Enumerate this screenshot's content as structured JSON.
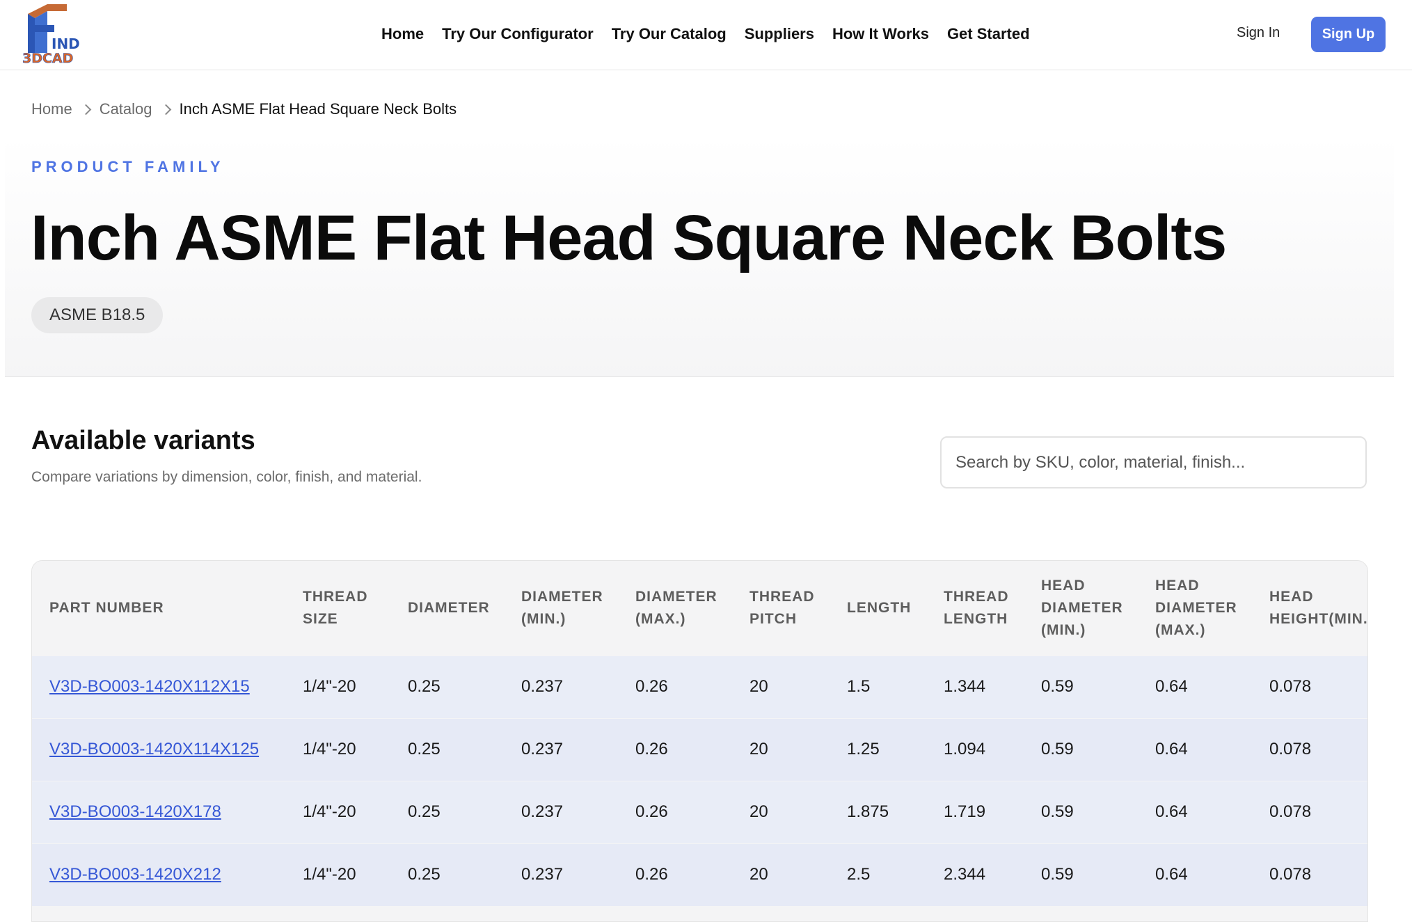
{
  "brand": {
    "logo_alt": "FIND 3DCAD",
    "logo_text_top": "IND",
    "logo_text_bottom": "3DCAD"
  },
  "nav": {
    "items": [
      {
        "label": "Home"
      },
      {
        "label": "Try Our Configurator"
      },
      {
        "label": "Try Our Catalog"
      },
      {
        "label": "Suppliers"
      },
      {
        "label": "How It Works"
      },
      {
        "label": "Get Started"
      }
    ],
    "sign_in": "Sign In",
    "sign_up": "Sign Up"
  },
  "breadcrumb": {
    "items": [
      {
        "label": "Home"
      },
      {
        "label": "Catalog"
      },
      {
        "label": "Inch ASME Flat Head Square Neck Bolts"
      }
    ]
  },
  "hero": {
    "eyebrow": "PRODUCT FAMILY",
    "title": "Inch ASME Flat Head Square Neck Bolts",
    "standard": "ASME B18.5"
  },
  "variants": {
    "title": "Available variants",
    "subtitle": "Compare variations by dimension, color, finish, and material.",
    "search_placeholder": "Search by SKU, color, material, finish..."
  },
  "table": {
    "columns": [
      "PART NUMBER",
      "THREAD SIZE",
      "DIAMETER",
      "DIAMETER (MIN.)",
      "DIAMETER (MAX.)",
      "THREAD PITCH",
      "LENGTH",
      "THREAD LENGTH",
      "HEAD DIAMETER (MIN.)",
      "HEAD DIAMETER (MAX.)",
      "HEAD HEIGHT(MIN."
    ],
    "rows": [
      [
        "V3D-BO003-1420X112X15",
        "1/4\"-20",
        "0.25",
        "0.237",
        "0.26",
        "20",
        "1.5",
        "1.344",
        "0.59",
        "0.64",
        "0.078"
      ],
      [
        "V3D-BO003-1420X114X125",
        "1/4\"-20",
        "0.25",
        "0.237",
        "0.26",
        "20",
        "1.25",
        "1.094",
        "0.59",
        "0.64",
        "0.078"
      ],
      [
        "V3D-BO003-1420X178",
        "1/4\"-20",
        "0.25",
        "0.237",
        "0.26",
        "20",
        "1.875",
        "1.719",
        "0.59",
        "0.64",
        "0.078"
      ],
      [
        "V3D-BO003-1420X212",
        "1/4\"-20",
        "0.25",
        "0.237",
        "0.26",
        "20",
        "2.5",
        "2.344",
        "0.59",
        "0.64",
        "0.078"
      ]
    ]
  },
  "colors": {
    "accent": "#4f74e3",
    "link": "#3557d6",
    "row_bg": "#e9edf7",
    "logo_blue": "#2b56b5",
    "logo_orange": "#d9662a"
  }
}
